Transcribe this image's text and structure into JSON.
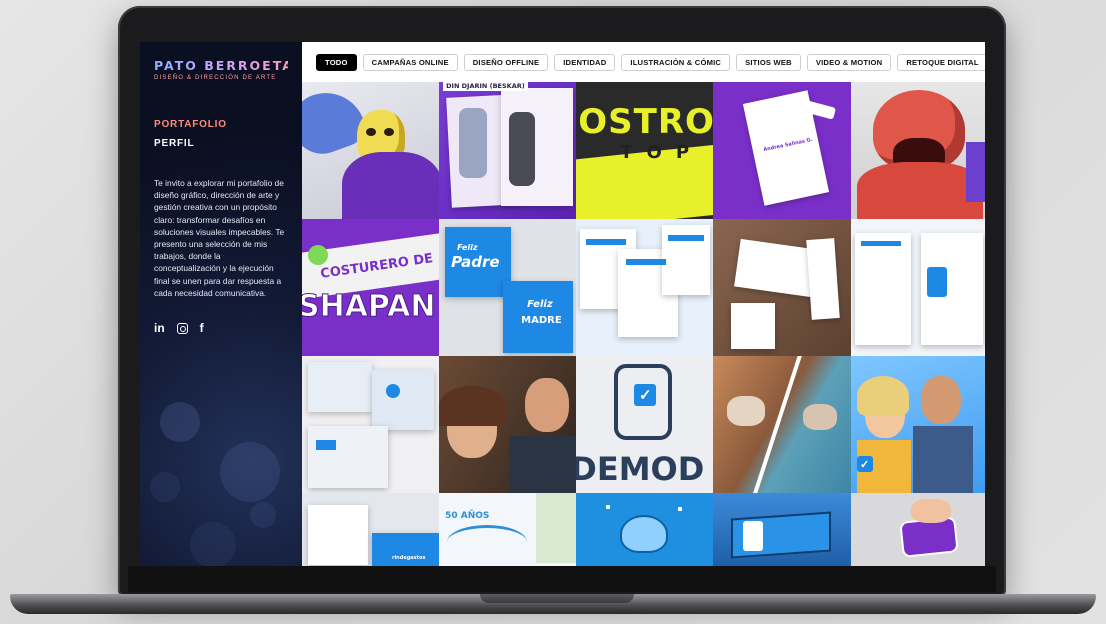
{
  "brand": {
    "name": "PATO BERROETA",
    "tagline": "DISEÑO & DIRECCIÓN DE ARTE"
  },
  "nav": {
    "portfolio": "PORTAFOLIO",
    "profile": "PERFIL"
  },
  "intro_text": "Te invito a explorar mi portafolio de diseño gráfico, dirección de arte y gestión creativa con un propósito claro: transformar desafíos en soluciones visuales impecables. Te presento una selección de mis trabajos, donde la conceptualización y la ejecución final se unen para dar respuesta a cada necesidad comunicativa.",
  "social": {
    "linkedin": "in",
    "instagram_icon": "instagram-icon",
    "facebook": "f"
  },
  "filters": [
    {
      "label": "TODO",
      "active": true
    },
    {
      "label": "CAMPAÑAS ONLINE"
    },
    {
      "label": "DISEÑO OFFLINE"
    },
    {
      "label": "IDENTIDAD"
    },
    {
      "label": "ILUSTRACIÓN & CÓMIC"
    },
    {
      "label": "SITIOS WEB"
    },
    {
      "label": "VIDEO & MOTION"
    },
    {
      "label": "RETOQUE DIGITAL"
    }
  ],
  "tiles": {
    "skeletor": {},
    "din_djarin": {
      "title": "DIN DJARIN (BESKAR)"
    },
    "gastronomia": {
      "text": "OSTRON",
      "sub": "TOP"
    },
    "stationery": {
      "name": "Andrea Salinas G."
    },
    "monster": {},
    "costurero": {
      "text": "COSTURERO DE",
      "big": "SHAPAN"
    },
    "padre": {
      "line1": "Feliz",
      "line2": "Padre"
    },
    "madre": {
      "line1": "Feliz",
      "line2": "MADRE"
    },
    "anios": {
      "text": "50 AÑOS"
    },
    "demo": {
      "text": "DEMOD"
    },
    "rindegastos": {
      "text": "rindegastos"
    }
  },
  "colors": {
    "accent": "#ff8c7a",
    "purple": "#7a2fc9",
    "blue": "#1e88e5",
    "yellow": "#e8f02a"
  }
}
